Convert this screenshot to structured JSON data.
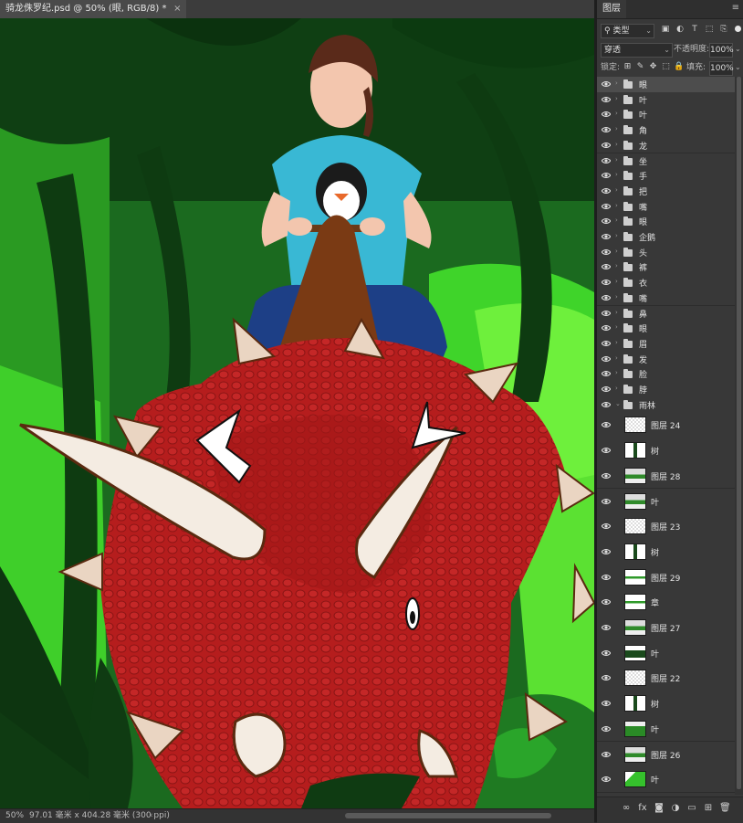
{
  "document": {
    "tab_title": "骑龙侏罗纪.psd @ 50% (眼, RGB/8) *",
    "close_symbol": "×"
  },
  "status": {
    "zoom": "50%",
    "doc_size": "97.01 毫米 x 404.28 毫米 (300 ppi)",
    "arrow": "‹"
  },
  "layers_panel": {
    "title": "图层",
    "filter": {
      "label": "类型",
      "icons": [
        "image-icon",
        "adjustment-icon",
        "type-icon",
        "shape-icon",
        "smart-object-icon"
      ]
    },
    "blend_mode": "穿透",
    "opacity_label": "不透明度:",
    "opacity_value": "100%",
    "lock_label": "锁定:",
    "fill_label": "填充:",
    "fill_value": "100%",
    "groups": [
      {
        "name": "眼",
        "selected": true
      },
      {
        "name": "叶"
      },
      {
        "name": "叶"
      },
      {
        "name": "角"
      },
      {
        "name": "龙"
      },
      {
        "name": "坐"
      },
      {
        "name": "手"
      },
      {
        "name": "把"
      },
      {
        "name": "嘴"
      },
      {
        "name": "眼"
      },
      {
        "name": "企鹅"
      },
      {
        "name": "头"
      },
      {
        "name": "裤"
      },
      {
        "name": "衣"
      },
      {
        "name": "嘴"
      },
      {
        "name": "鼻"
      },
      {
        "name": "眼"
      },
      {
        "name": "眉"
      },
      {
        "name": "发"
      },
      {
        "name": "脸"
      },
      {
        "name": "脖"
      },
      {
        "name": "雨林",
        "expanded": true
      }
    ],
    "sublayers": [
      {
        "name": "图层 24",
        "thumb": "checker"
      },
      {
        "name": "树",
        "thumb": "checker-dark"
      },
      {
        "name": "图层 28",
        "thumb": "checker-green"
      },
      {
        "name": "叶",
        "thumb": "checker-green"
      },
      {
        "name": "图层 23",
        "thumb": "checker"
      },
      {
        "name": "树",
        "thumb": "checker-dark"
      },
      {
        "name": "图层 29",
        "thumb": "green-line"
      },
      {
        "name": "章",
        "thumb": "green-line"
      },
      {
        "name": "图层 27",
        "thumb": "checker-green"
      },
      {
        "name": "叶",
        "thumb": "dark-green"
      },
      {
        "name": "图层 22",
        "thumb": "checker"
      },
      {
        "name": "树",
        "thumb": "checker-dark"
      },
      {
        "name": "叶",
        "thumb": "green"
      },
      {
        "name": "图层 26",
        "thumb": "checker-green"
      },
      {
        "name": "叶",
        "thumb": "bright-green"
      }
    ],
    "footer_icons": [
      "link-icon",
      "fx-icon",
      "mask-icon",
      "adjustment-layer-icon",
      "new-group-icon",
      "new-layer-icon",
      "trash-icon"
    ]
  },
  "colors": {
    "panel_bg": "#383838",
    "selected_row": "#4d4d4d",
    "dino_red": "#b01e1e",
    "jungle_dark": "#134b17",
    "jungle_bright": "#3fd42a"
  }
}
